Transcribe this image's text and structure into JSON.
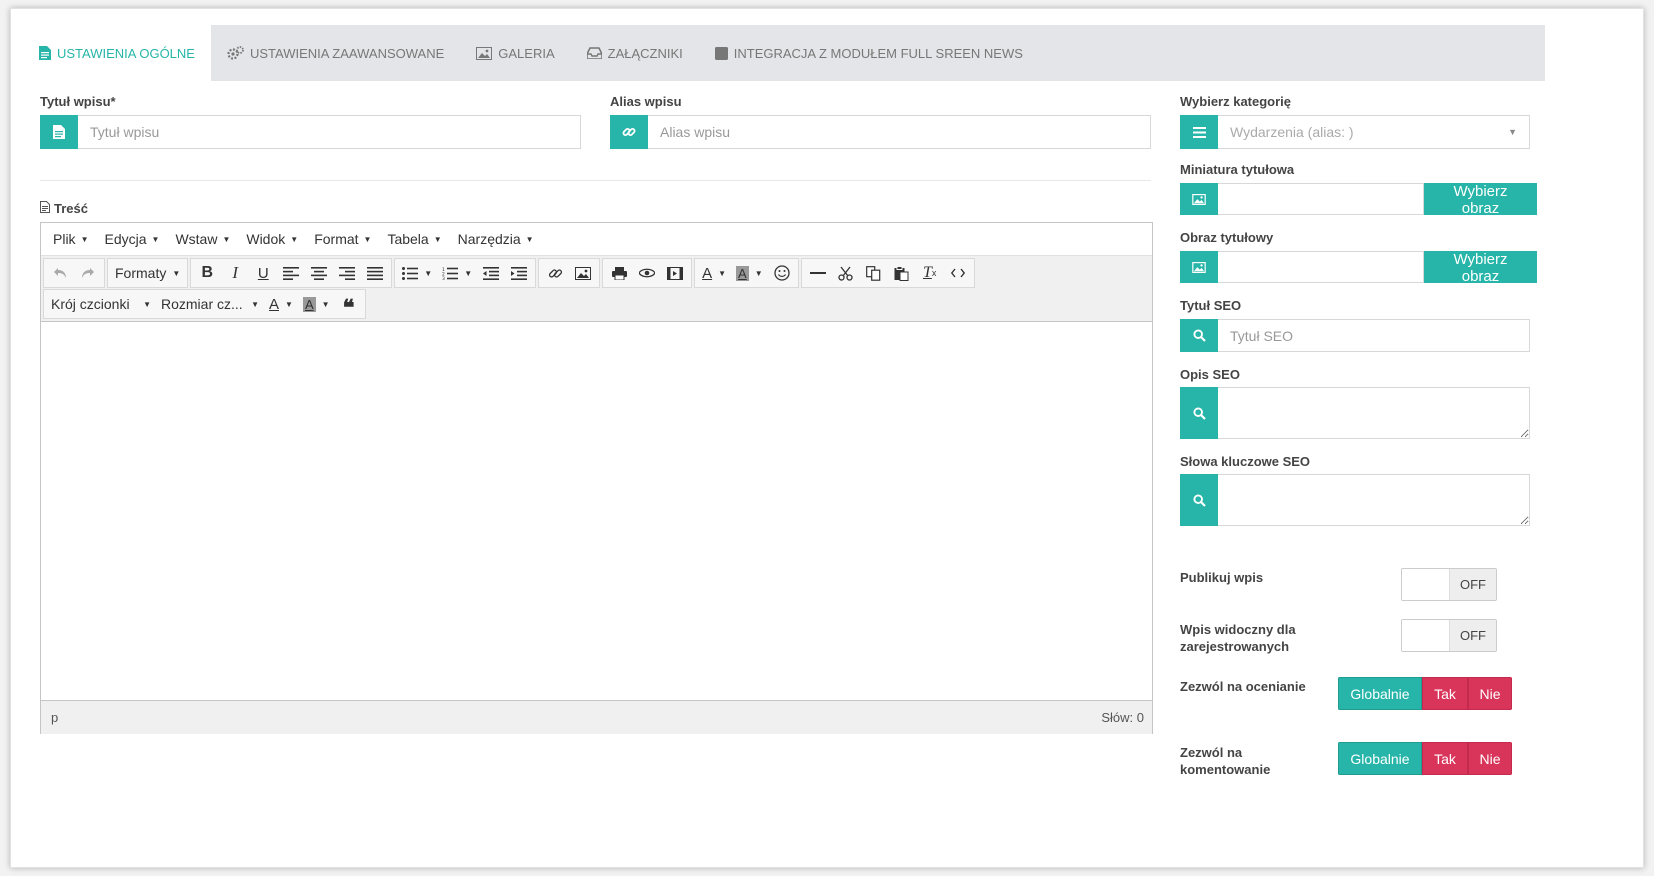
{
  "tabs": [
    {
      "label": "USTAWIENIA OGÓLNE",
      "icon": "document-icon",
      "active": true
    },
    {
      "label": "USTAWIENIA ZAAWANSOWANE",
      "icon": "gears-icon",
      "active": false
    },
    {
      "label": "GALERIA",
      "icon": "image-icon",
      "active": false
    },
    {
      "label": "ZAŁĄCZNIKI",
      "icon": "inbox-icon",
      "active": false
    },
    {
      "label": "INTEGRACJA Z MODUŁEM FULL SREEN NEWS",
      "icon": "square-icon",
      "active": false
    }
  ],
  "form": {
    "title_label": "Tytuł wpisu*",
    "title_placeholder": "Tytuł wpisu",
    "alias_label": "Alias wpisu",
    "alias_placeholder": "Alias wpisu",
    "content_label": "Treść"
  },
  "editor": {
    "menu": [
      "Plik",
      "Edycja",
      "Wstaw",
      "Widok",
      "Format",
      "Tabela",
      "Narzędzia"
    ],
    "formats_label": "Formaty",
    "font_label": "Krój czcionki",
    "size_label": "Rozmiar cz...",
    "status_path": "p",
    "word_count": "Słów: 0"
  },
  "sidebar": {
    "category_label": "Wybierz kategorię",
    "category_value": "Wydarzenia (alias: )",
    "thumb_label": "Miniatura tytułowa",
    "thumb_button": "Wybierz obraz",
    "image_label": "Obraz tytułowy",
    "image_button": "Wybierz obraz",
    "seo_title_label": "Tytuł SEO",
    "seo_title_placeholder": "Tytuł SEO",
    "seo_desc_label": "Opis SEO",
    "seo_keywords_label": "Słowa kluczowe SEO",
    "publish_label": "Publikuj wpis",
    "publish_state": "OFF",
    "registered_label_1": "Wpis widoczny dla",
    "registered_label_2": "zarejestrowanych",
    "registered_state": "OFF",
    "rating_label": "Zezwól na ocenianie",
    "comments_label_1": "Zezwól na",
    "comments_label_2": "komentowanie",
    "opt_global": "Globalnie",
    "opt_yes": "Tak",
    "opt_no": "Nie"
  },
  "colors": {
    "accent": "#26b5a8",
    "danger": "#d9345a"
  }
}
